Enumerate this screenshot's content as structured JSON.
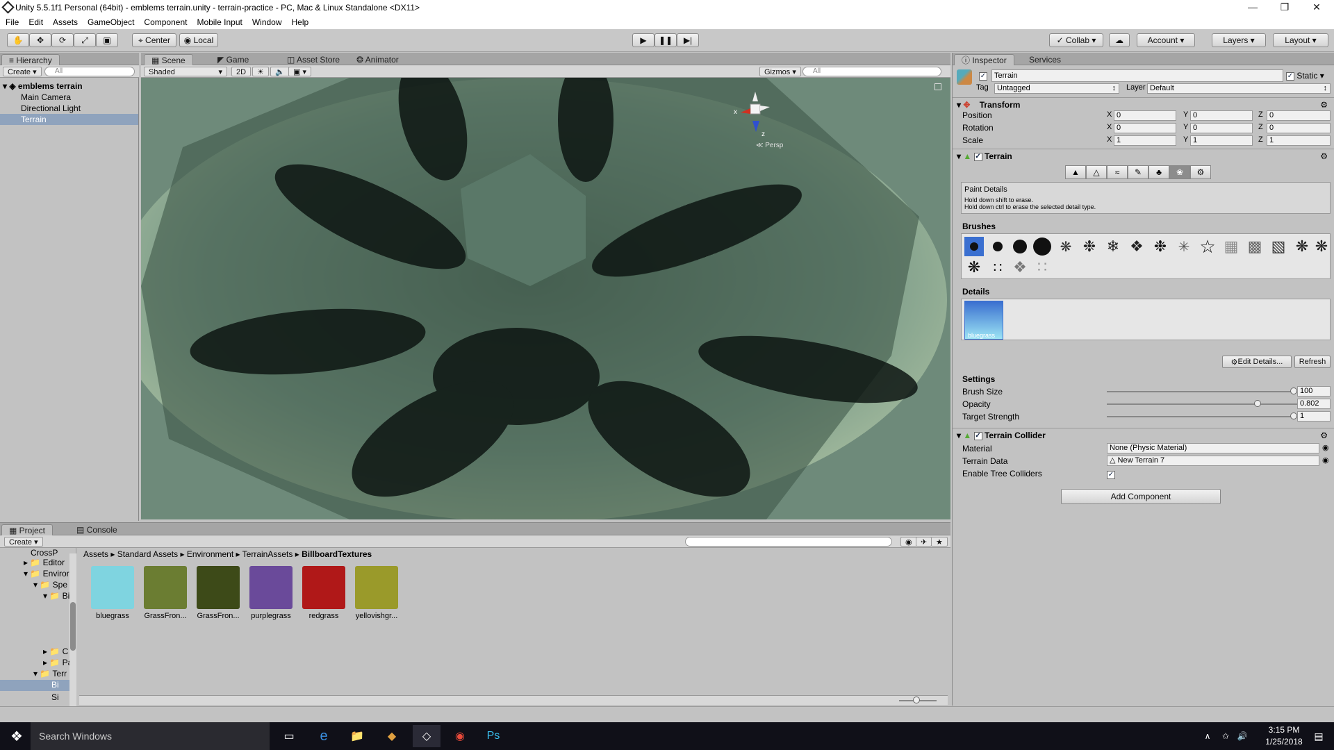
{
  "window": {
    "title": "Unity 5.5.1f1 Personal (64bit) - emblems terrain.unity - terrain-practice - PC, Mac & Linux Standalone <DX11>"
  },
  "menu": [
    "File",
    "Edit",
    "Assets",
    "GameObject",
    "Component",
    "Mobile Input",
    "Window",
    "Help"
  ],
  "toolbar": {
    "center": "Center",
    "local": "Local",
    "collab": "Collab",
    "account": "Account",
    "layers": "Layers",
    "layout": "Layout"
  },
  "hierarchy": {
    "tab": "Hierarchy",
    "create": "Create",
    "search": "All",
    "scene": "emblems terrain",
    "items": [
      "Main Camera",
      "Directional Light",
      "Terrain"
    ]
  },
  "scene": {
    "tabs": [
      "Scene",
      "Game",
      "Asset Store",
      "Animator"
    ],
    "shading": "Shaded",
    "mode2d": "2D",
    "gizmos": "Gizmos",
    "search": "All",
    "persp": "Persp",
    "axis_x": "x",
    "axis_z": "z"
  },
  "inspector": {
    "tabs": [
      "Inspector",
      "Services"
    ],
    "object_name": "Terrain",
    "static": "Static",
    "tag_label": "Tag",
    "tag_value": "Untagged",
    "layer_label": "Layer",
    "layer_value": "Default",
    "transform": {
      "header": "Transform",
      "labels": [
        "Position",
        "Rotation",
        "Scale"
      ],
      "position": [
        "0",
        "0",
        "0"
      ],
      "rotation": [
        "0",
        "0",
        "0"
      ],
      "scale": [
        "1",
        "1",
        "1"
      ]
    },
    "terrain": {
      "header": "Terrain",
      "paint_title": "Paint Details",
      "hint1": "Hold down shift to erase.",
      "hint2": "Hold down ctrl to erase the selected detail type.",
      "brushes": "Brushes",
      "details": "Details",
      "detail_name": "bluegrass",
      "edit_details": "Edit Details...",
      "refresh": "Refresh",
      "settings": "Settings",
      "brush_size_label": "Brush Size",
      "brush_size": "100",
      "opacity_label": "Opacity",
      "opacity": "0.802",
      "target_label": "Target Strength",
      "target": "1"
    },
    "collider": {
      "header": "Terrain Collider",
      "material_label": "Material",
      "material": "None (Physic Material)",
      "data_label": "Terrain Data",
      "data": "New Terrain 7",
      "tree_label": "Enable Tree Colliders"
    },
    "add_component": "Add Component"
  },
  "project": {
    "tabs": [
      "Project",
      "Console"
    ],
    "create": "Create",
    "breadcrumb": [
      "Assets",
      "Standard Assets",
      "Environment",
      "TerrainAssets",
      "BillboardTextures"
    ],
    "tree": [
      "CrossP",
      "Editor",
      "Enviror",
      "Spe",
      "Bi",
      "C",
      "Pa",
      "Terr",
      "Bi",
      "Si"
    ],
    "assets": [
      {
        "name": "bluegrass",
        "color": "#7fd4e0"
      },
      {
        "name": "GrassFron...",
        "color": "#6b7d32"
      },
      {
        "name": "GrassFron...",
        "color": "#3d4a18"
      },
      {
        "name": "purplegrass",
        "color": "#6a4a9a"
      },
      {
        "name": "redgrass",
        "color": "#b01818"
      },
      {
        "name": "yellovishgr...",
        "color": "#9a9a2a"
      }
    ]
  },
  "taskbar": {
    "search": "Search Windows",
    "time": "3:15 PM",
    "date": "1/25/2018"
  }
}
